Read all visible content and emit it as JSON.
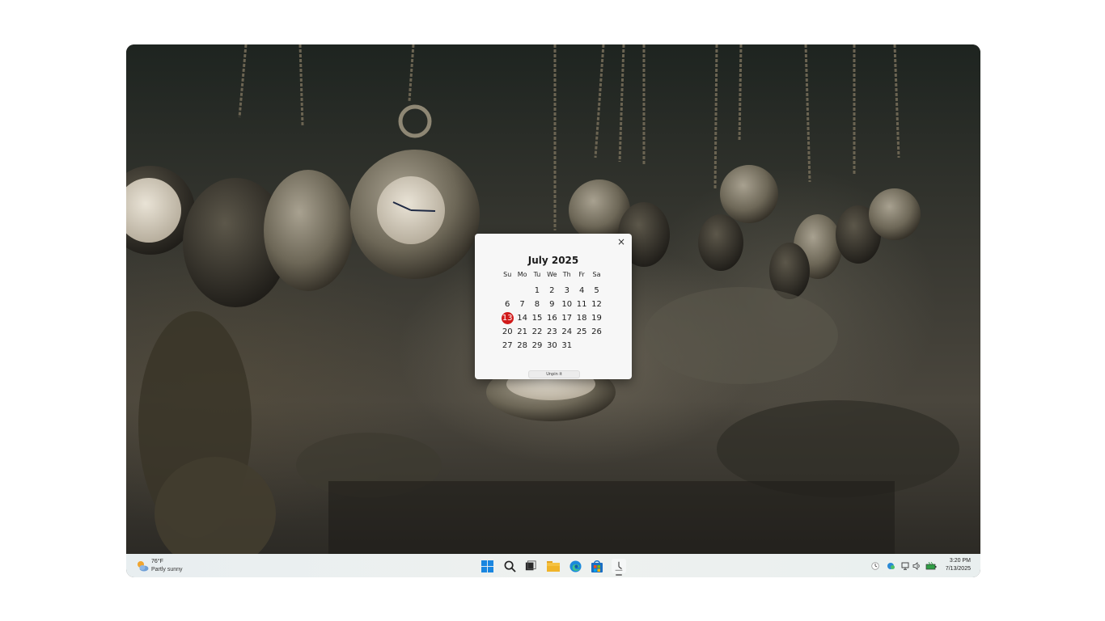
{
  "calendar": {
    "close_label": "×",
    "month_title": "July 2025",
    "weekdays": [
      "Su",
      "Mo",
      "Tu",
      "We",
      "Th",
      "Fr",
      "Sa"
    ],
    "weeks": [
      [
        "",
        "",
        "1",
        "2",
        "3",
        "4",
        "5"
      ],
      [
        "6",
        "7",
        "8",
        "9",
        "10",
        "11",
        "12"
      ],
      [
        "13",
        "14",
        "15",
        "16",
        "17",
        "18",
        "19"
      ],
      [
        "20",
        "21",
        "22",
        "23",
        "24",
        "25",
        "26"
      ],
      [
        "27",
        "28",
        "29",
        "30",
        "31",
        "",
        ""
      ]
    ],
    "today": "13",
    "today_color": "#d11a1a",
    "unpin_label": "Unpin it"
  },
  "taskbar": {
    "weather": {
      "temp": "76°F",
      "condition": "Partly sunny",
      "icon": "partly-sunny-icon"
    },
    "apps": [
      {
        "name": "start-button",
        "icon": "windows-logo-icon"
      },
      {
        "name": "search-button",
        "icon": "search-icon"
      },
      {
        "name": "task-view-button",
        "icon": "task-view-icon"
      },
      {
        "name": "file-explorer-button",
        "icon": "folder-icon"
      },
      {
        "name": "edge-button",
        "icon": "edge-icon"
      },
      {
        "name": "store-button",
        "icon": "store-icon"
      },
      {
        "name": "clock-app-button",
        "icon": "clock-icon",
        "active": true
      }
    ],
    "tray": [
      "clock-icon",
      "onedrive-icon",
      "network-icon",
      "volume-icon",
      "battery-icon"
    ],
    "time": "3:20 PM",
    "date": "7/13/2025"
  }
}
